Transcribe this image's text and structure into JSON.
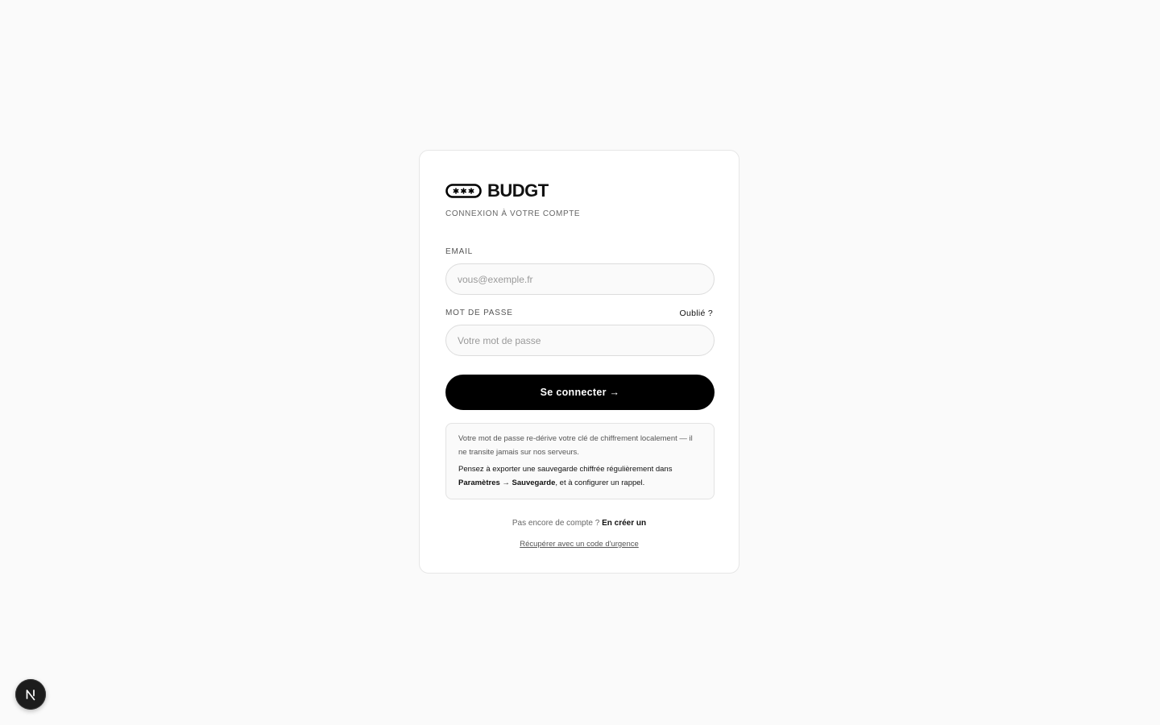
{
  "brand": {
    "name": "BUDGT",
    "logo_icon": "masked-password-icon",
    "subtitle": "CONNEXION À VOTRE COMPTE"
  },
  "form": {
    "email": {
      "label": "EMAIL",
      "placeholder": "vous@exemple.fr",
      "value": ""
    },
    "password": {
      "label": "MOT DE PASSE",
      "placeholder": "Votre mot de passe",
      "value": "",
      "forgot_label": "Oublié ?"
    },
    "submit_label": "Se connecter →"
  },
  "notice": {
    "line1": "Votre mot de passe re-dérive votre clé de chiffrement localement — il ne transite jamais sur nos serveurs.",
    "line2_prefix": "Pensez à exporter une sauvegarde chiffrée régulièrement dans ",
    "line2_bold": "Paramètres → Sauvegarde",
    "line2_suffix": ", et à configurer un rappel."
  },
  "footer": {
    "no_account_text": "Pas encore de compte ?",
    "signup_label": "En créer un",
    "recover_label": "Récupérer avec un code d'urgence"
  },
  "dev_badge": {
    "letter": "N",
    "icon": "nextjs-logo-icon"
  },
  "colors": {
    "background": "#fafafa",
    "card": "#ffffff",
    "primary": "#000000",
    "text_muted": "#666666"
  }
}
